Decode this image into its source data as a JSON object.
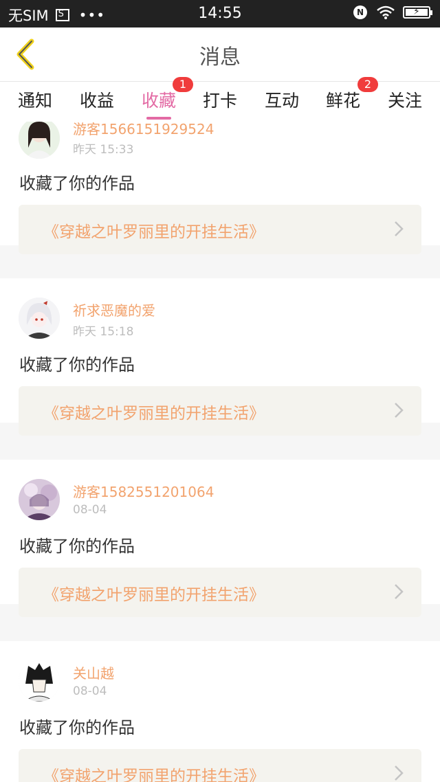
{
  "status_bar": {
    "carrier": "无SIM",
    "dots": "•••",
    "time": "14:55",
    "nfc": "N"
  },
  "header": {
    "title": "消息"
  },
  "tabs": [
    {
      "label": "通知"
    },
    {
      "label": "收益"
    },
    {
      "label": "收藏",
      "badge": "1"
    },
    {
      "label": "打卡"
    },
    {
      "label": "互动"
    },
    {
      "label": "鲜花",
      "badge": "2"
    },
    {
      "label": "关注"
    }
  ],
  "messages": [
    {
      "user": "游客1566151929524",
      "date": "昨天 15:33",
      "action": "收藏了你的作品",
      "work": "《穿越之叶罗丽里的开挂生活》"
    },
    {
      "user": "祈求恶魔的爱",
      "date": "昨天 15:18",
      "action": "收藏了你的作品",
      "work": "《穿越之叶罗丽里的开挂生活》"
    },
    {
      "user": "游客1582551201064",
      "date": "08-04",
      "action": "收藏了你的作品",
      "work": "《穿越之叶罗丽里的开挂生活》"
    },
    {
      "user": "关山越",
      "date": "08-04",
      "action": "收藏了你的作品",
      "work": "《穿越之叶罗丽里的开挂生活》"
    }
  ],
  "colors": {
    "accent": "#e36aa4",
    "name": "#f2a36e",
    "badge": "#f03c3c",
    "back_icon": "#f0d21c"
  },
  "icons": {
    "back": "chevron-left-icon",
    "row": "chevron-right-icon"
  }
}
